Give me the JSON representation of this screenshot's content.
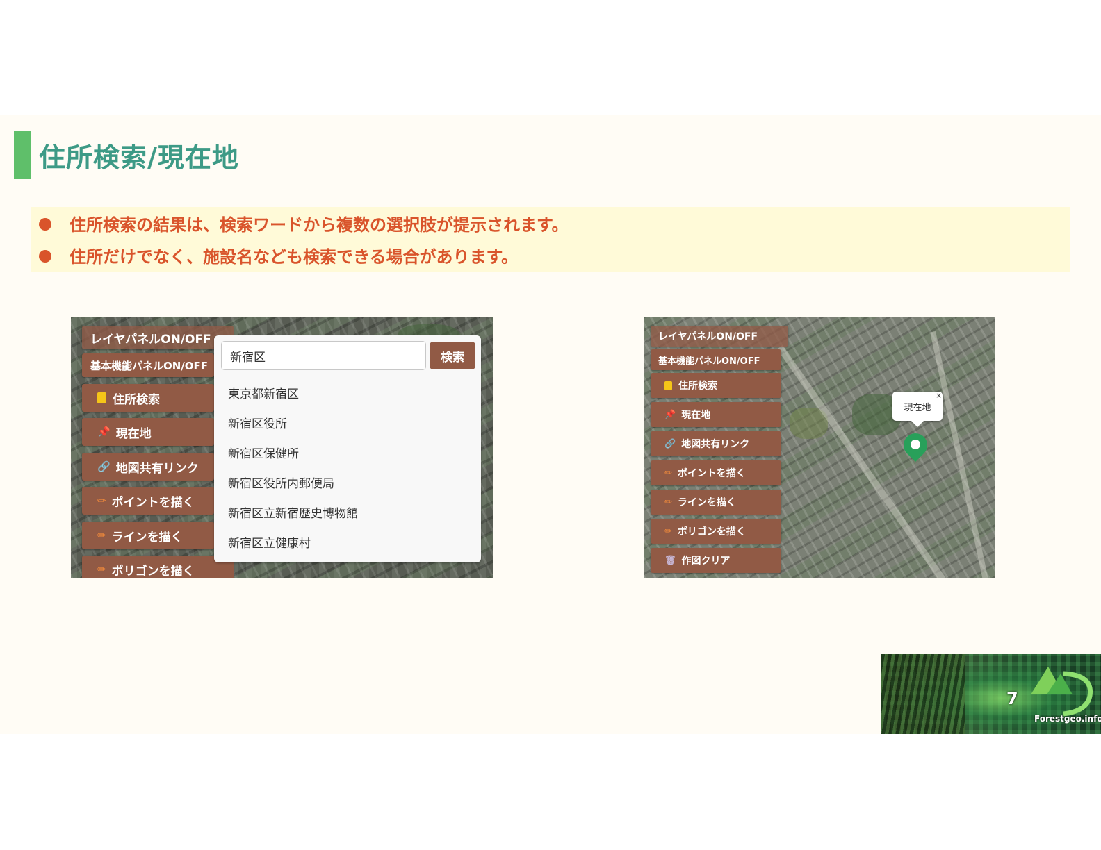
{
  "slide": {
    "title": "住所検索/現在地",
    "bullets": [
      "住所検索の結果は、検索ワードから複数の選択肢が提示されます。",
      "住所だけでなく、施設名なども検索できる場合があります。"
    ],
    "page_number": "7",
    "logo_text": "Forestgeo.info"
  },
  "left_screenshot": {
    "buttons": [
      {
        "label": "レイヤパネルON/OFF",
        "icon": ""
      },
      {
        "label": "基本機能パネルON/OFF",
        "icon": ""
      },
      {
        "label": "住所検索",
        "icon": "notebook-icon"
      },
      {
        "label": "現在地",
        "icon": "pushpin-icon"
      },
      {
        "label": "地図共有リンク",
        "icon": "link-icon"
      },
      {
        "label": "ポイントを描く",
        "icon": "pencil-icon"
      },
      {
        "label": "ラインを描く",
        "icon": "pencil-icon"
      },
      {
        "label": "ポリゴンを描く",
        "icon": "pencil-icon"
      }
    ],
    "search": {
      "input_value": "新宿区",
      "button_label": "検索",
      "results": [
        "東京都新宿区",
        "新宿区役所",
        "新宿区保健所",
        "新宿区役所内郵便局",
        "新宿区立新宿歴史博物館",
        "新宿区立健康村"
      ]
    }
  },
  "right_screenshot": {
    "buttons": [
      {
        "label": "レイヤパネルON/OFF",
        "icon": ""
      },
      {
        "label": "基本機能パネルON/OFF",
        "icon": ""
      },
      {
        "label": "住所検索",
        "icon": "notebook-icon"
      },
      {
        "label": "現在地",
        "icon": "pushpin-icon"
      },
      {
        "label": "地図共有リンク",
        "icon": "link-icon"
      },
      {
        "label": "ポイントを描く",
        "icon": "pencil-icon"
      },
      {
        "label": "ラインを描く",
        "icon": "pencil-icon"
      },
      {
        "label": "ポリゴンを描く",
        "icon": "pencil-icon"
      },
      {
        "label": "作図クリア",
        "icon": "wastebasket-icon"
      }
    ],
    "popup": {
      "label": "現在地",
      "close": "×"
    }
  },
  "colors": {
    "title": "#3d9a86",
    "accent_bar": "#5fbf6a",
    "bullet_text": "#d9542b",
    "bullet_bg": "#fffad8",
    "button_bg": "#915a45",
    "marker": "#28a05a"
  }
}
